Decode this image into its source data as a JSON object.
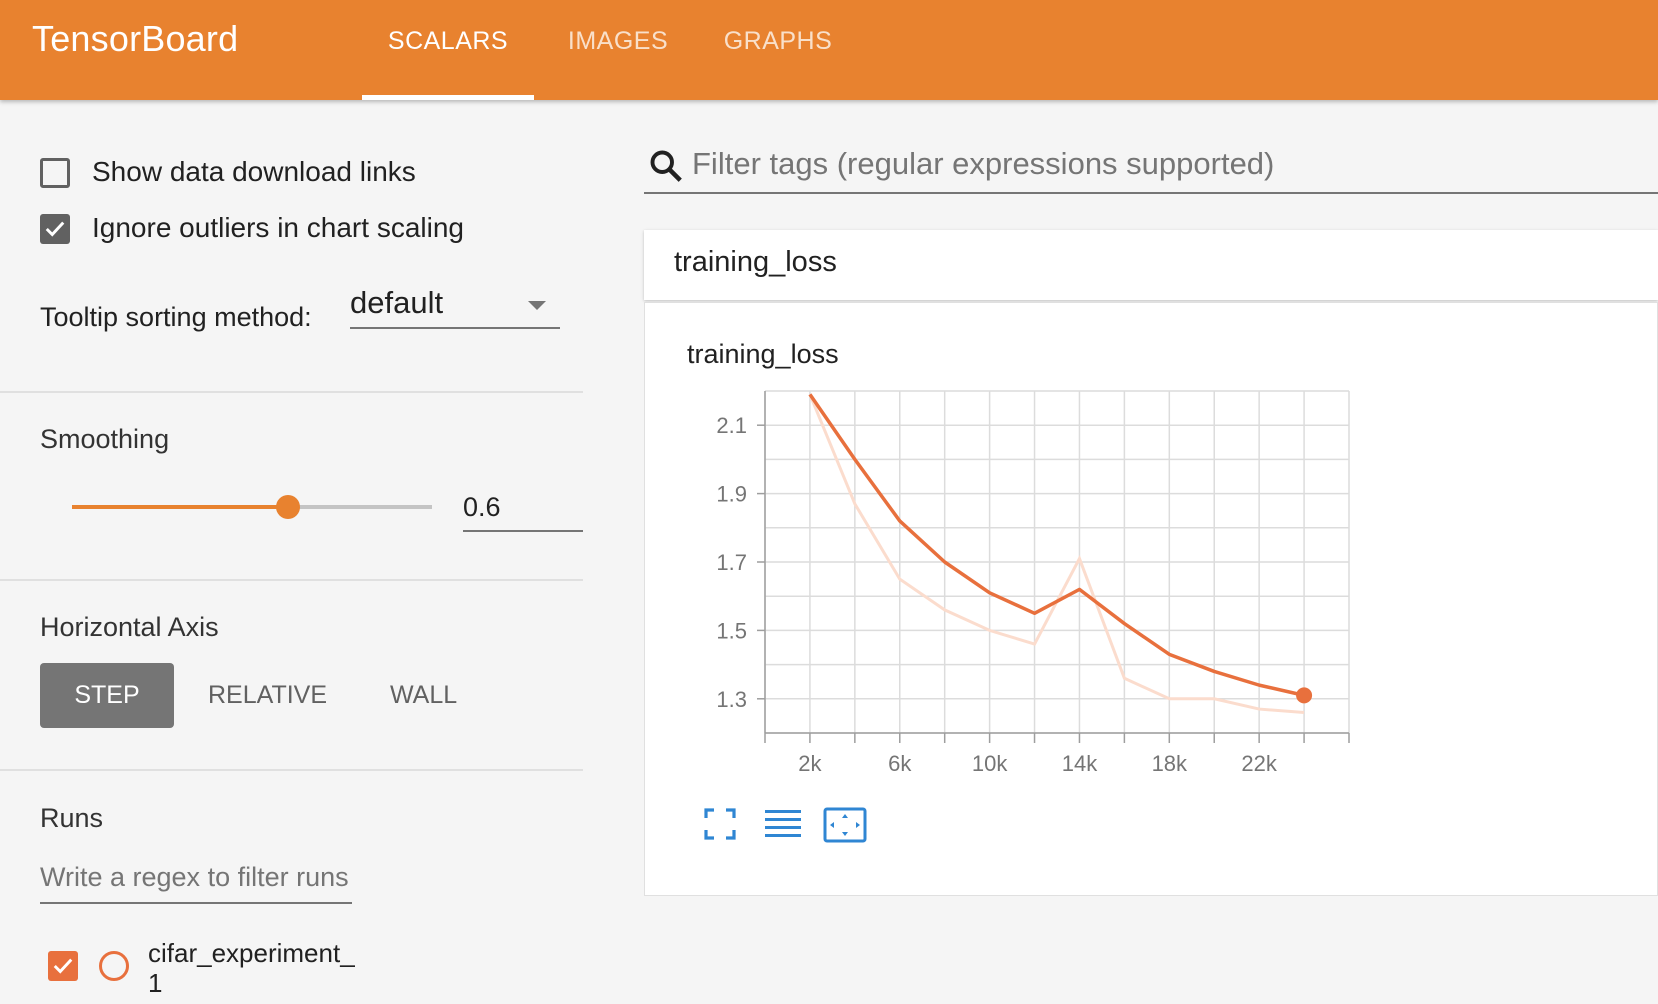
{
  "app": {
    "title": "TensorBoard",
    "tabs": [
      {
        "label": "SCALARS",
        "active": true
      },
      {
        "label": "IMAGES",
        "active": false
      },
      {
        "label": "GRAPHS",
        "active": false
      }
    ]
  },
  "sidebar": {
    "show_download_links": {
      "label": "Show data download links",
      "checked": false
    },
    "ignore_outliers": {
      "label": "Ignore outliers in chart scaling",
      "checked": true
    },
    "tooltip_sorting": {
      "label": "Tooltip sorting method:",
      "value": "default"
    },
    "smoothing": {
      "title": "Smoothing",
      "value": "0.6",
      "slider_fraction": 0.6
    },
    "horizontal_axis": {
      "title": "Horizontal Axis",
      "options": [
        "STEP",
        "RELATIVE",
        "WALL"
      ],
      "selected": "STEP"
    },
    "runs": {
      "title": "Runs",
      "filter_placeholder": "Write a regex to filter runs",
      "items": [
        {
          "name": "cifar_experiment_1",
          "checked": true
        }
      ]
    }
  },
  "main": {
    "filter_placeholder": "Filter tags (regular expressions supported)",
    "card_title": "training_loss"
  },
  "colors": {
    "header": "#e8822f",
    "series": "#e8703d",
    "series_raw": "#fbdccd"
  },
  "chart_data": {
    "type": "line",
    "title": "training_loss",
    "xlabel": "",
    "ylabel": "",
    "x_ticks": [
      "2k",
      "6k",
      "10k",
      "14k",
      "18k",
      "22k"
    ],
    "y_ticks": [
      "1.3",
      "1.5",
      "1.7",
      "1.9",
      "2.1"
    ],
    "xlim": [
      0,
      26000
    ],
    "ylim": [
      1.2,
      2.2
    ],
    "grid": true,
    "series": [
      {
        "style": "smoothed",
        "x": [
          2000,
          4000,
          6000,
          8000,
          10000,
          12000,
          14000,
          16000,
          18000,
          20000,
          22000,
          24000
        ],
        "y": [
          2.19,
          2.0,
          1.82,
          1.7,
          1.61,
          1.55,
          1.62,
          1.52,
          1.43,
          1.38,
          1.34,
          1.31
        ]
      },
      {
        "style": "raw",
        "x": [
          2000,
          4000,
          6000,
          8000,
          10000,
          12000,
          14000,
          16000,
          18000,
          20000,
          22000,
          24000
        ],
        "y": [
          2.19,
          1.87,
          1.65,
          1.56,
          1.5,
          1.46,
          1.71,
          1.36,
          1.3,
          1.3,
          1.27,
          1.26
        ]
      }
    ]
  },
  "chart_controls": [
    "fullscreen-icon",
    "toggle-log-scale-icon",
    "fit-domain-icon"
  ]
}
